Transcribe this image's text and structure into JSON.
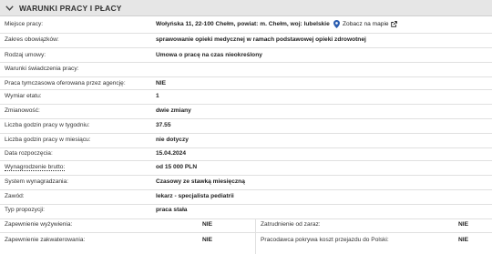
{
  "section": {
    "title": "WARUNKI PRACY I PŁACY"
  },
  "rows": {
    "miejsce": {
      "label": "Miejsce pracy:",
      "value": "Wołyńska 11, 22-100 Chełm, powiat: m. Chełm, woj: lubelskie"
    },
    "map_link": "Zobacz na mapie",
    "zakres": {
      "label": "Zakres obowiązków:",
      "value": "sprawowanie opieki medycznej w ramach podstawowej opieki zdrowotnej"
    },
    "rodzaj": {
      "label": "Rodzaj umowy:",
      "value": "Umowa o pracę na czas nieokreślony"
    },
    "warunki": {
      "label": "Warunki świadczenia pracy:",
      "value": ""
    },
    "tymczasowa": {
      "label": "Praca tymczasowa oferowana przez agencję:",
      "value": "NIE"
    },
    "wymiar": {
      "label": "Wymiar etatu:",
      "value": "1"
    },
    "zmianowosc": {
      "label": "Zmianowość:",
      "value": "dwie zmiany"
    },
    "godz_tydz": {
      "label": "Liczba godzin pracy w tygodniu:",
      "value": "37.55"
    },
    "godz_mies": {
      "label": "Liczba godzin pracy w miesiącu:",
      "value": "nie dotyczy"
    },
    "data": {
      "label": "Data rozpoczęcia:",
      "value": "15.04.2024"
    },
    "wynagrodzenie": {
      "label": "Wynagrodzenie brutto:",
      "value": "od 15 000 PLN"
    },
    "system": {
      "label": "System wynagradzania:",
      "value": "Czasowy ze stawką miesięczną"
    },
    "zawod": {
      "label": "Zawód:",
      "value": "lekarz - specjalista pediatrii"
    },
    "typ": {
      "label": "Typ propozycji:",
      "value": "praca stała"
    }
  },
  "bottom": {
    "wyzywienie": {
      "label": "Zapewnienie wyżywienia:",
      "value": "NIE"
    },
    "zatrudnienie": {
      "label": "Zatrudnienie od zaraz:",
      "value": "NIE"
    },
    "zakwaterowanie": {
      "label": "Zapewnienie zakwaterowania:",
      "value": "NIE"
    },
    "przejazd": {
      "label": "Pracodawca pokrywa koszt przejazdu do Polski:",
      "value": "NIE"
    }
  }
}
